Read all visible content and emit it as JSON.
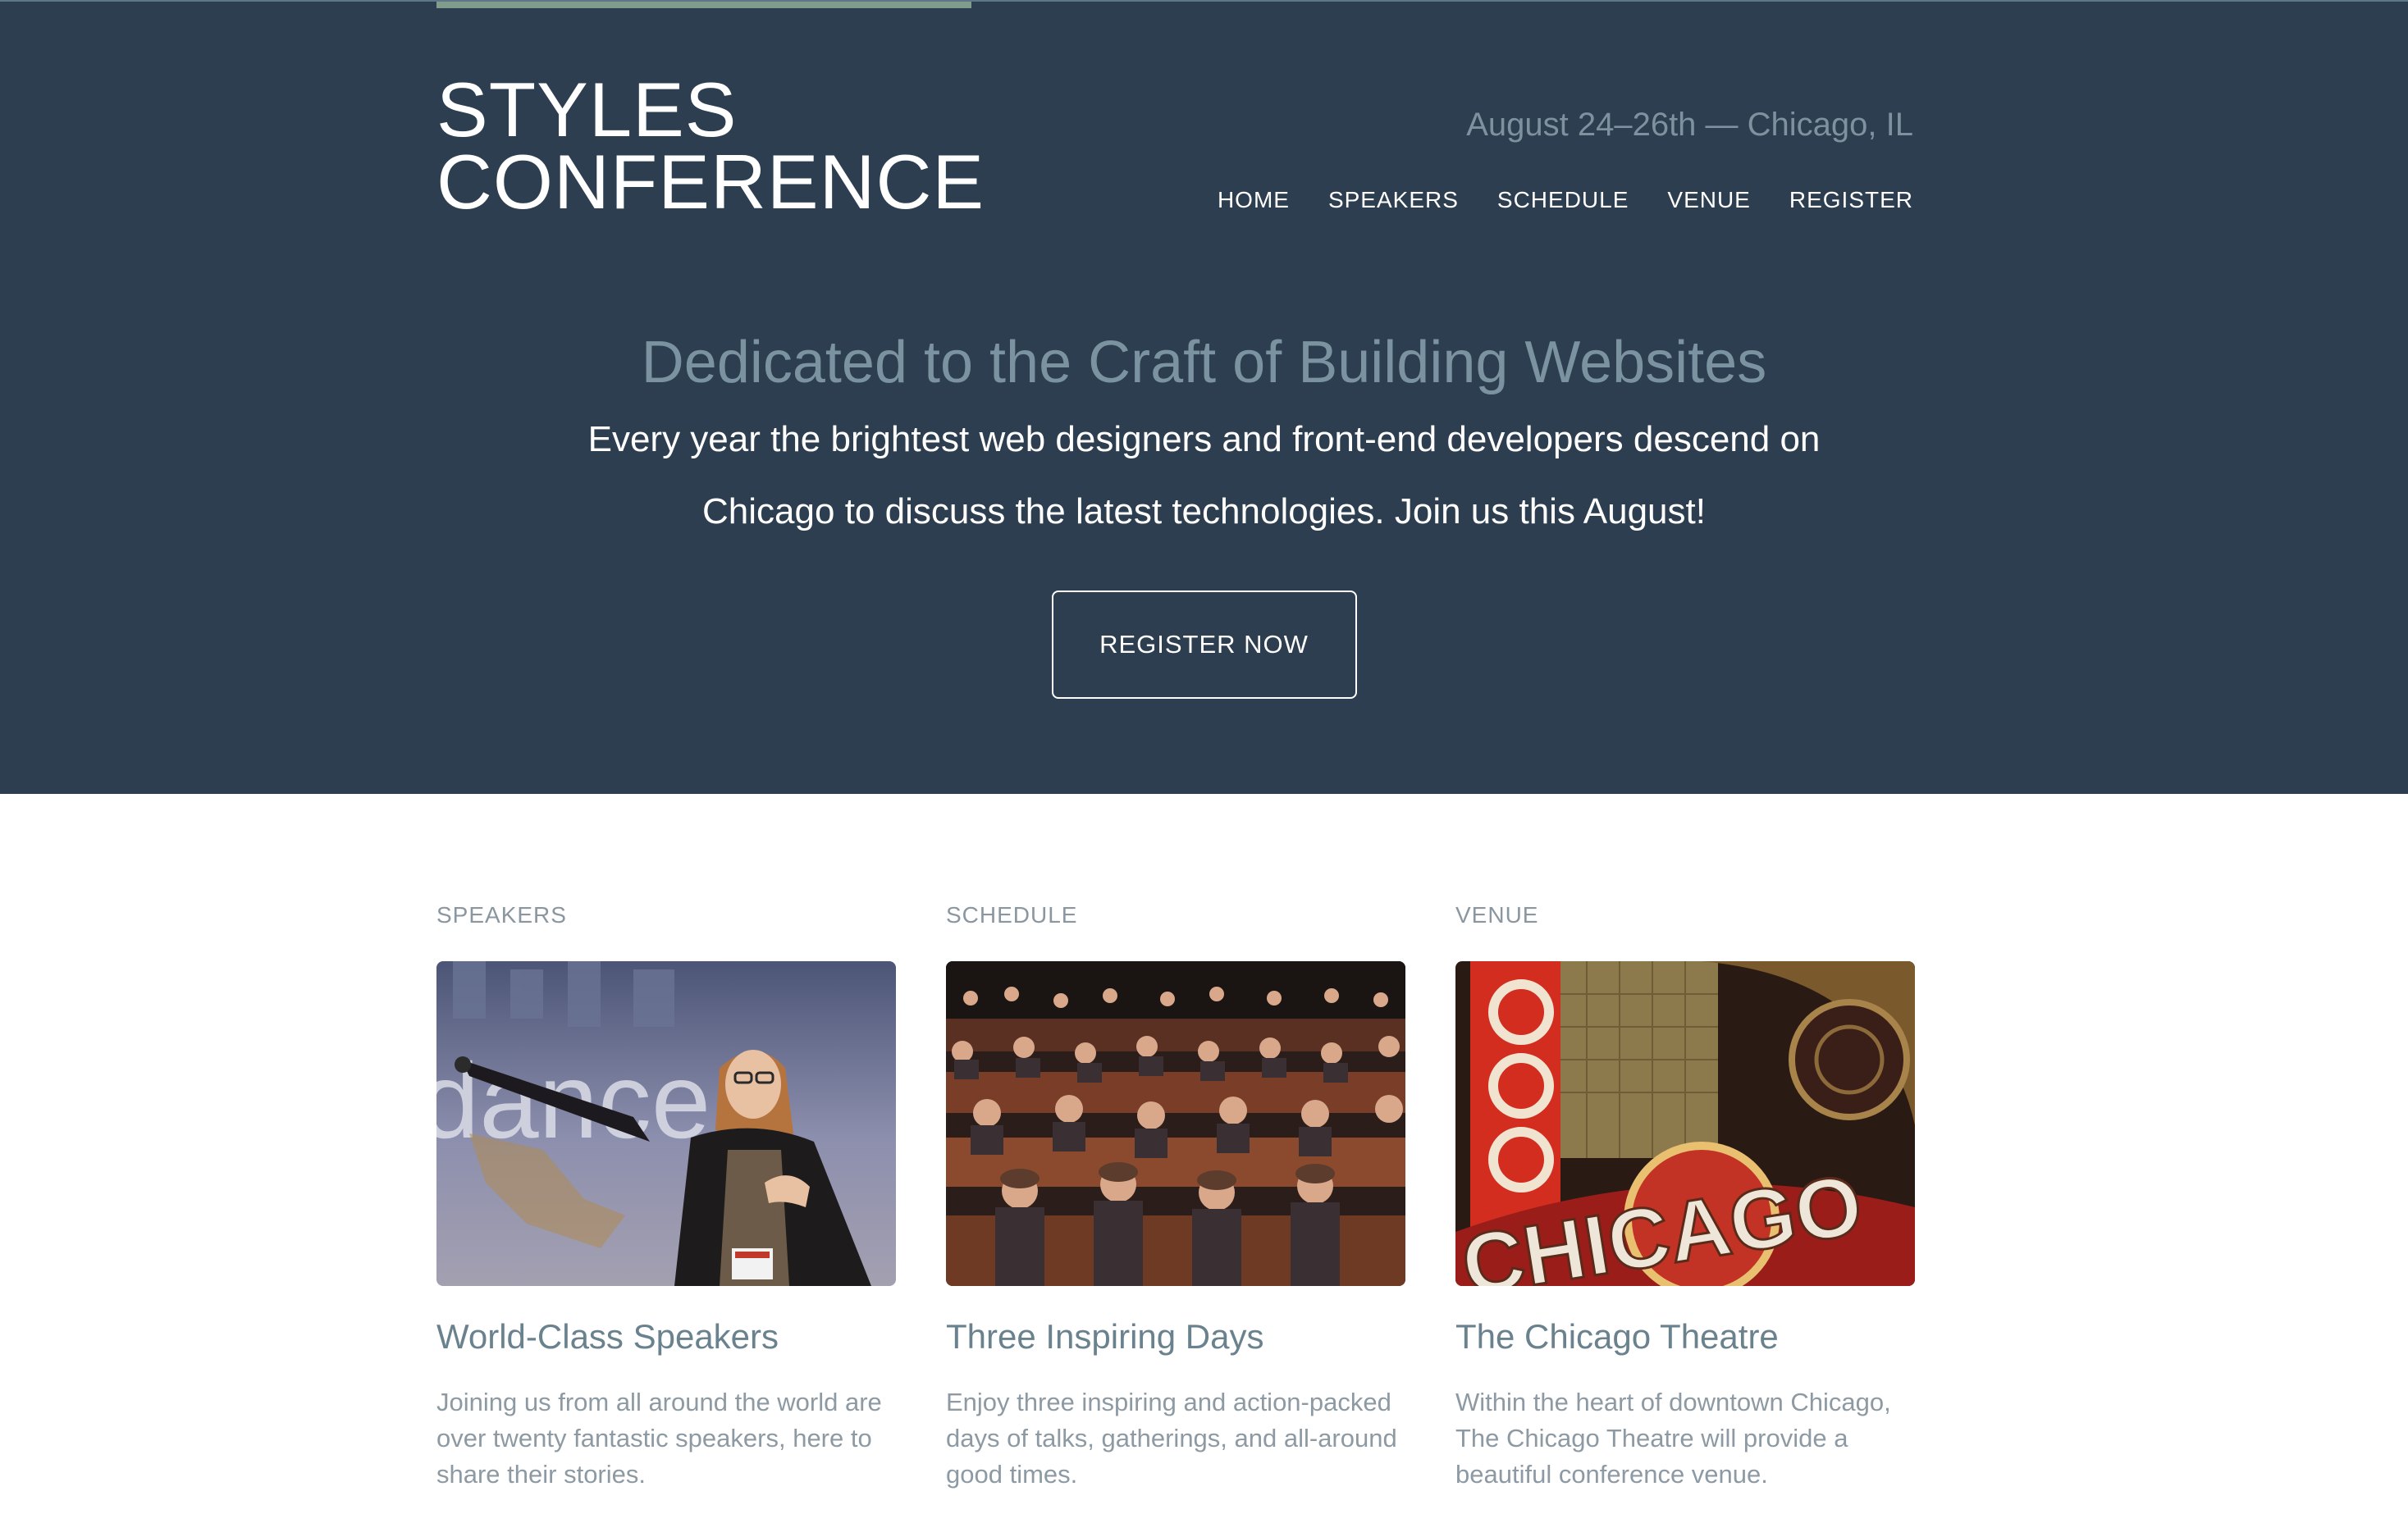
{
  "logo": {
    "line1": "STYLES",
    "line2": "CONFERENCE"
  },
  "header": {
    "tagline": "August 24–26th — Chicago, IL"
  },
  "nav": {
    "items": [
      {
        "label": "HOME"
      },
      {
        "label": "SPEAKERS"
      },
      {
        "label": "SCHEDULE"
      },
      {
        "label": "VENUE"
      },
      {
        "label": "REGISTER"
      }
    ]
  },
  "hero": {
    "title": "Dedicated to the Craft of Building Websites",
    "text_line1": "Every year the brightest web designers and front-end developers descend on",
    "text_line2": "Chicago to discuss the latest technologies. Join us this August!",
    "cta_label": "REGISTER NOW"
  },
  "cards": [
    {
      "label": "SPEAKERS",
      "title": "World-Class Speakers",
      "text": "Joining us from all around the world are over twenty fantastic speakers, here to share their stories."
    },
    {
      "label": "SCHEDULE",
      "title": "Three Inspiring Days",
      "text": "Enjoy three inspiring and action-packed days of talks, gatherings, and all-around good times."
    },
    {
      "label": "VENUE",
      "title": "The Chicago Theatre",
      "text": "Within the heart of downtown Chicago, The Chicago Theatre will provide a beautiful conference venue.",
      "image_sign_text": "CHICAGO"
    }
  ],
  "colors": {
    "header_bg": "#2c3e4f",
    "accent": "#7f9c8c",
    "hero_title": "#7b93a0",
    "card_title": "#6a818e",
    "card_text": "#8d9aa3"
  }
}
